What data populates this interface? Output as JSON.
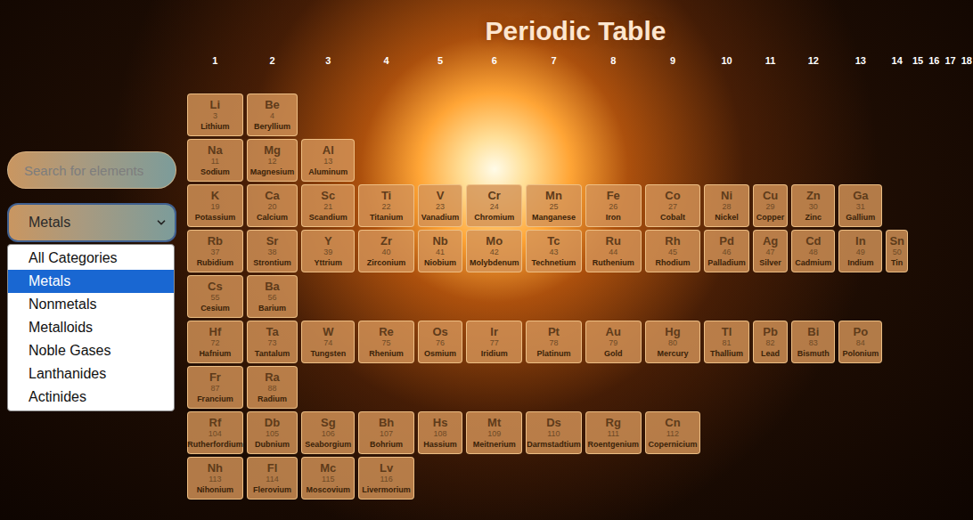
{
  "title": "Periodic Table",
  "groups": [
    "1",
    "2",
    "3",
    "4",
    "5",
    "6",
    "7",
    "8",
    "9",
    "10",
    "11",
    "12",
    "13",
    "14",
    "15",
    "16",
    "17",
    "18"
  ],
  "search": {
    "placeholder": "Search for elements"
  },
  "category_filter": {
    "value": "Metals",
    "expanded": true,
    "options": [
      {
        "label": "All Categories",
        "selected": false
      },
      {
        "label": "Metals",
        "selected": true
      },
      {
        "label": "Nonmetals",
        "selected": false
      },
      {
        "label": "Metalloids",
        "selected": false
      },
      {
        "label": "Noble Gases",
        "selected": false
      },
      {
        "label": "Lanthanides",
        "selected": false
      },
      {
        "label": "Actinides",
        "selected": false
      }
    ]
  },
  "element_rows": [
    {
      "elements": [
        {
          "symbol": "Li",
          "number": "3",
          "name": "Lithium"
        },
        {
          "symbol": "Be",
          "number": "4",
          "name": "Beryllium"
        }
      ]
    },
    {
      "elements": [
        {
          "symbol": "Na",
          "number": "11",
          "name": "Sodium"
        },
        {
          "symbol": "Mg",
          "number": "12",
          "name": "Magnesium"
        },
        {
          "symbol": "Al",
          "number": "13",
          "name": "Aluminum"
        }
      ]
    },
    {
      "elements": [
        {
          "symbol": "K",
          "number": "19",
          "name": "Potassium"
        },
        {
          "symbol": "Ca",
          "number": "20",
          "name": "Calcium"
        },
        {
          "symbol": "Sc",
          "number": "21",
          "name": "Scandium"
        },
        {
          "symbol": "Ti",
          "number": "22",
          "name": "Titanium"
        },
        {
          "symbol": "V",
          "number": "23",
          "name": "Vanadium"
        },
        {
          "symbol": "Cr",
          "number": "24",
          "name": "Chromium"
        },
        {
          "symbol": "Mn",
          "number": "25",
          "name": "Manganese"
        },
        {
          "symbol": "Fe",
          "number": "26",
          "name": "Iron"
        },
        {
          "symbol": "Co",
          "number": "27",
          "name": "Cobalt"
        },
        {
          "symbol": "Ni",
          "number": "28",
          "name": "Nickel"
        },
        {
          "symbol": "Cu",
          "number": "29",
          "name": "Copper"
        },
        {
          "symbol": "Zn",
          "number": "30",
          "name": "Zinc"
        },
        {
          "symbol": "Ga",
          "number": "31",
          "name": "Gallium"
        }
      ]
    },
    {
      "elements": [
        {
          "symbol": "Rb",
          "number": "37",
          "name": "Rubidium"
        },
        {
          "symbol": "Sr",
          "number": "38",
          "name": "Strontium"
        },
        {
          "symbol": "Y",
          "number": "39",
          "name": "Yttrium"
        },
        {
          "symbol": "Zr",
          "number": "40",
          "name": "Zirconium"
        },
        {
          "symbol": "Nb",
          "number": "41",
          "name": "Niobium"
        },
        {
          "symbol": "Mo",
          "number": "42",
          "name": "Molybdenum"
        },
        {
          "symbol": "Tc",
          "number": "43",
          "name": "Technetium"
        },
        {
          "symbol": "Ru",
          "number": "44",
          "name": "Ruthenium"
        },
        {
          "symbol": "Rh",
          "number": "45",
          "name": "Rhodium"
        },
        {
          "symbol": "Pd",
          "number": "46",
          "name": "Palladium"
        },
        {
          "symbol": "Ag",
          "number": "47",
          "name": "Silver"
        },
        {
          "symbol": "Cd",
          "number": "48",
          "name": "Cadmium"
        },
        {
          "symbol": "In",
          "number": "49",
          "name": "Indium"
        },
        {
          "symbol": "Sn",
          "number": "50",
          "name": "Tin"
        }
      ]
    },
    {
      "elements": [
        {
          "symbol": "Cs",
          "number": "55",
          "name": "Cesium"
        },
        {
          "symbol": "Ba",
          "number": "56",
          "name": "Barium"
        }
      ]
    },
    {
      "elements": [
        {
          "symbol": "Hf",
          "number": "72",
          "name": "Hafnium"
        },
        {
          "symbol": "Ta",
          "number": "73",
          "name": "Tantalum"
        },
        {
          "symbol": "W",
          "number": "74",
          "name": "Tungsten"
        },
        {
          "symbol": "Re",
          "number": "75",
          "name": "Rhenium"
        },
        {
          "symbol": "Os",
          "number": "76",
          "name": "Osmium"
        },
        {
          "symbol": "Ir",
          "number": "77",
          "name": "Iridium"
        },
        {
          "symbol": "Pt",
          "number": "78",
          "name": "Platinum"
        },
        {
          "symbol": "Au",
          "number": "79",
          "name": "Gold"
        },
        {
          "symbol": "Hg",
          "number": "80",
          "name": "Mercury"
        },
        {
          "symbol": "Tl",
          "number": "81",
          "name": "Thallium"
        },
        {
          "symbol": "Pb",
          "number": "82",
          "name": "Lead"
        },
        {
          "symbol": "Bi",
          "number": "83",
          "name": "Bismuth"
        },
        {
          "symbol": "Po",
          "number": "84",
          "name": "Polonium"
        }
      ]
    },
    {
      "elements": [
        {
          "symbol": "Fr",
          "number": "87",
          "name": "Francium"
        },
        {
          "symbol": "Ra",
          "number": "88",
          "name": "Radium"
        }
      ]
    },
    {
      "elements": [
        {
          "symbol": "Rf",
          "number": "104",
          "name": "Rutherfordium"
        },
        {
          "symbol": "Db",
          "number": "105",
          "name": "Dubnium"
        },
        {
          "symbol": "Sg",
          "number": "106",
          "name": "Seaborgium"
        },
        {
          "symbol": "Bh",
          "number": "107",
          "name": "Bohrium"
        },
        {
          "symbol": "Hs",
          "number": "108",
          "name": "Hassium"
        },
        {
          "symbol": "Mt",
          "number": "109",
          "name": "Meitnerium"
        },
        {
          "symbol": "Ds",
          "number": "110",
          "name": "Darmstadtium"
        },
        {
          "symbol": "Rg",
          "number": "111",
          "name": "Roentgenium"
        },
        {
          "symbol": "Cn",
          "number": "112",
          "name": "Copernicium"
        }
      ]
    },
    {
      "elements": [
        {
          "symbol": "Nh",
          "number": "113",
          "name": "Nihonium"
        },
        {
          "symbol": "Fl",
          "number": "114",
          "name": "Flerovium"
        },
        {
          "symbol": "Mc",
          "number": "115",
          "name": "Moscovium"
        },
        {
          "symbol": "Lv",
          "number": "116",
          "name": "Livermorium"
        }
      ]
    }
  ]
}
